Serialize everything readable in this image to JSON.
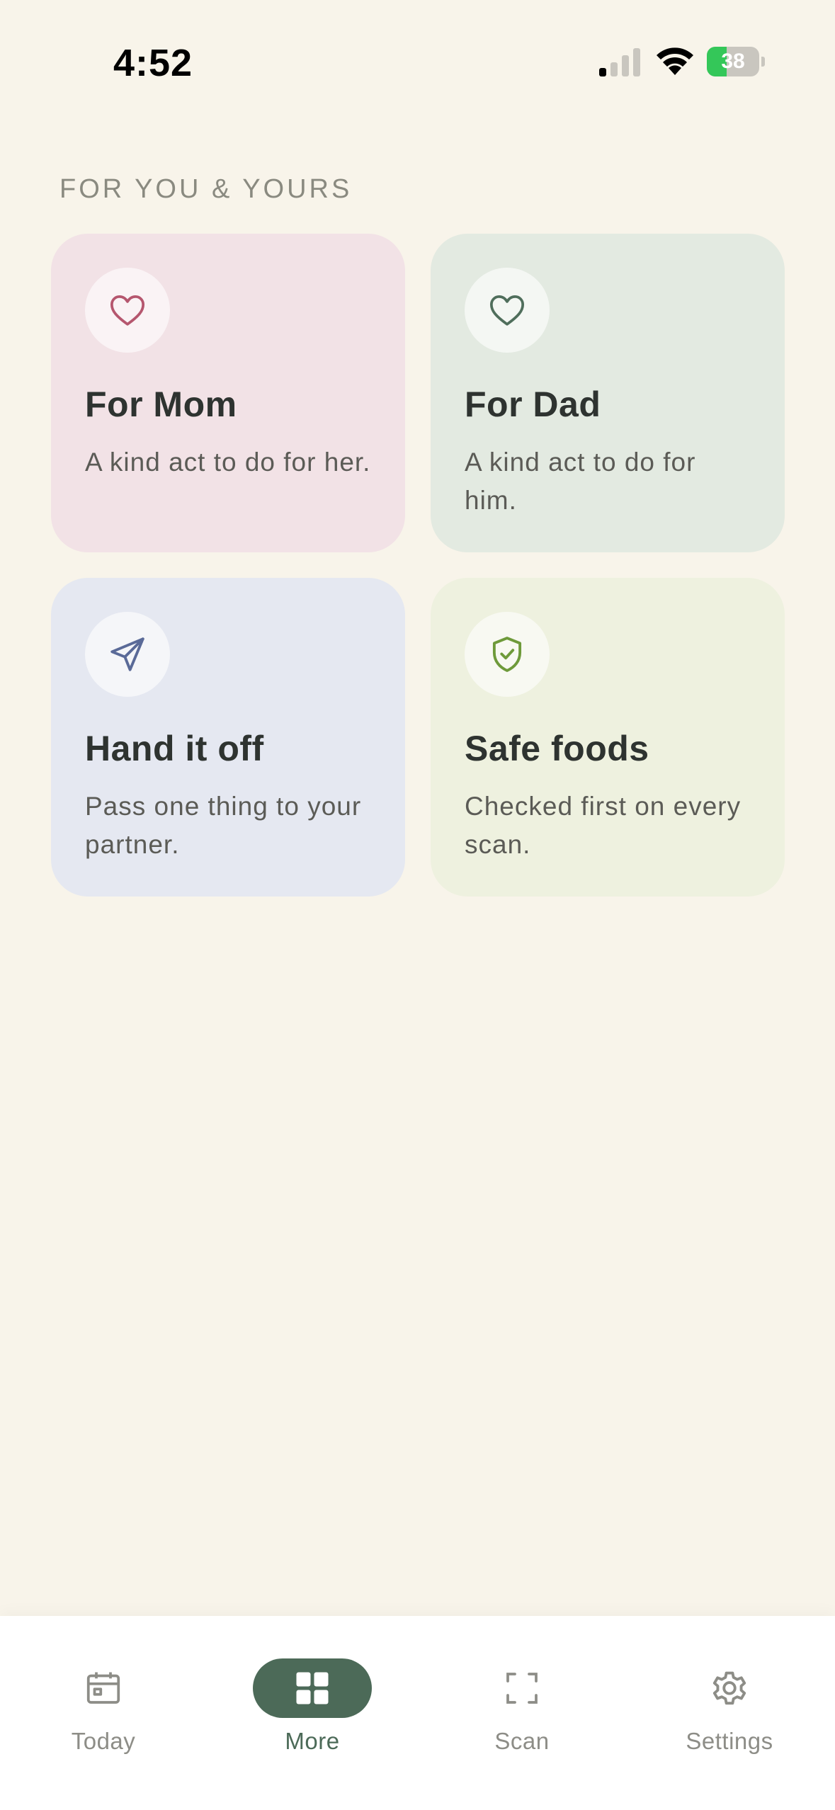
{
  "status_bar": {
    "time": "4:52",
    "battery_percent": "38",
    "battery_level": 0.38,
    "battery_color": "#34c759"
  },
  "section": {
    "title": "FOR YOU & YOURS"
  },
  "cards": [
    {
      "title": "For Mom",
      "subtitle": "A kind act to do for her.",
      "icon": "heart-icon",
      "accent": "#b5566e",
      "bg": "#f2e2e6"
    },
    {
      "title": "For Dad",
      "subtitle": "A kind act to do for him.",
      "icon": "heart-icon",
      "accent": "#4f6e5b",
      "bg": "#e3eae1"
    },
    {
      "title": "Hand it off",
      "subtitle": "Pass one thing to your partner.",
      "icon": "paper-plane-icon",
      "accent": "#5a6a98",
      "bg": "#e5e8f1"
    },
    {
      "title": "Safe foods",
      "subtitle": "Checked first on every scan.",
      "icon": "shield-check-icon",
      "accent": "#6e9a3a",
      "bg": "#eef1df"
    }
  ],
  "tab_bar": {
    "tabs": [
      {
        "label": "Today",
        "icon": "calendar-icon"
      },
      {
        "label": "More",
        "icon": "grid-icon",
        "selected": true
      },
      {
        "label": "Scan",
        "icon": "scan-frame-icon"
      },
      {
        "label": "Settings",
        "icon": "gear-icon"
      }
    ],
    "active_color": "#4c6a58",
    "inactive_color": "#8d8d87"
  }
}
